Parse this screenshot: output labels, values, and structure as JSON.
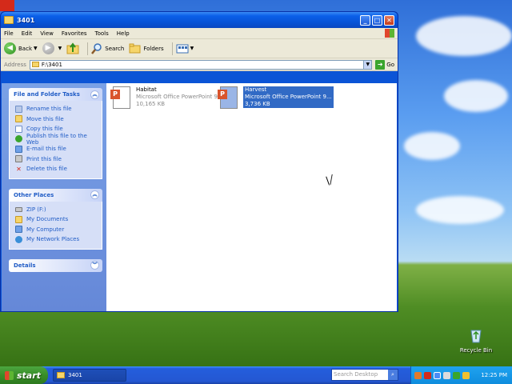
{
  "window": {
    "title": "3401",
    "controls": {
      "minimize": "_",
      "maximize": "□",
      "close": "✕"
    }
  },
  "menu": [
    "File",
    "Edit",
    "View",
    "Favorites",
    "Tools",
    "Help"
  ],
  "toolbar": {
    "back": "Back",
    "search": "Search",
    "folders": "Folders"
  },
  "address": {
    "label": "Address",
    "value": "F:\\3401",
    "go": "Go"
  },
  "tasks": {
    "file_folder": {
      "title": "File and Folder Tasks",
      "items": [
        {
          "label": "Rename this file",
          "icon": "rename-icon"
        },
        {
          "label": "Move this file",
          "icon": "move-icon"
        },
        {
          "label": "Copy this file",
          "icon": "copy-icon"
        },
        {
          "label": "Publish this file to the Web",
          "icon": "web-icon"
        },
        {
          "label": "E-mail this file",
          "icon": "email-icon"
        },
        {
          "label": "Print this file",
          "icon": "print-icon"
        },
        {
          "label": "Delete this file",
          "icon": "delete-icon"
        }
      ]
    },
    "other_places": {
      "title": "Other Places",
      "items": [
        {
          "label": "ZIP (F:)",
          "icon": "drive-icon"
        },
        {
          "label": "My Documents",
          "icon": "documents-icon"
        },
        {
          "label": "My Computer",
          "icon": "computer-icon"
        },
        {
          "label": "My Network Places",
          "icon": "network-icon"
        }
      ]
    },
    "details": {
      "title": "Details"
    }
  },
  "files": [
    {
      "name": "Habitat",
      "type": "Microsoft Office PowerPoint 9...",
      "size": "10,165 KB",
      "selected": false
    },
    {
      "name": "Harvest",
      "type": "Microsoft Office PowerPoint 9...",
      "size": "3,736 KB",
      "selected": true
    }
  ],
  "desktop": {
    "recycle_bin": "Recycle Bin"
  },
  "taskbar": {
    "start": "start",
    "task": "3401",
    "search_placeholder": "Search Desktop",
    "clock": "12:25 PM"
  }
}
